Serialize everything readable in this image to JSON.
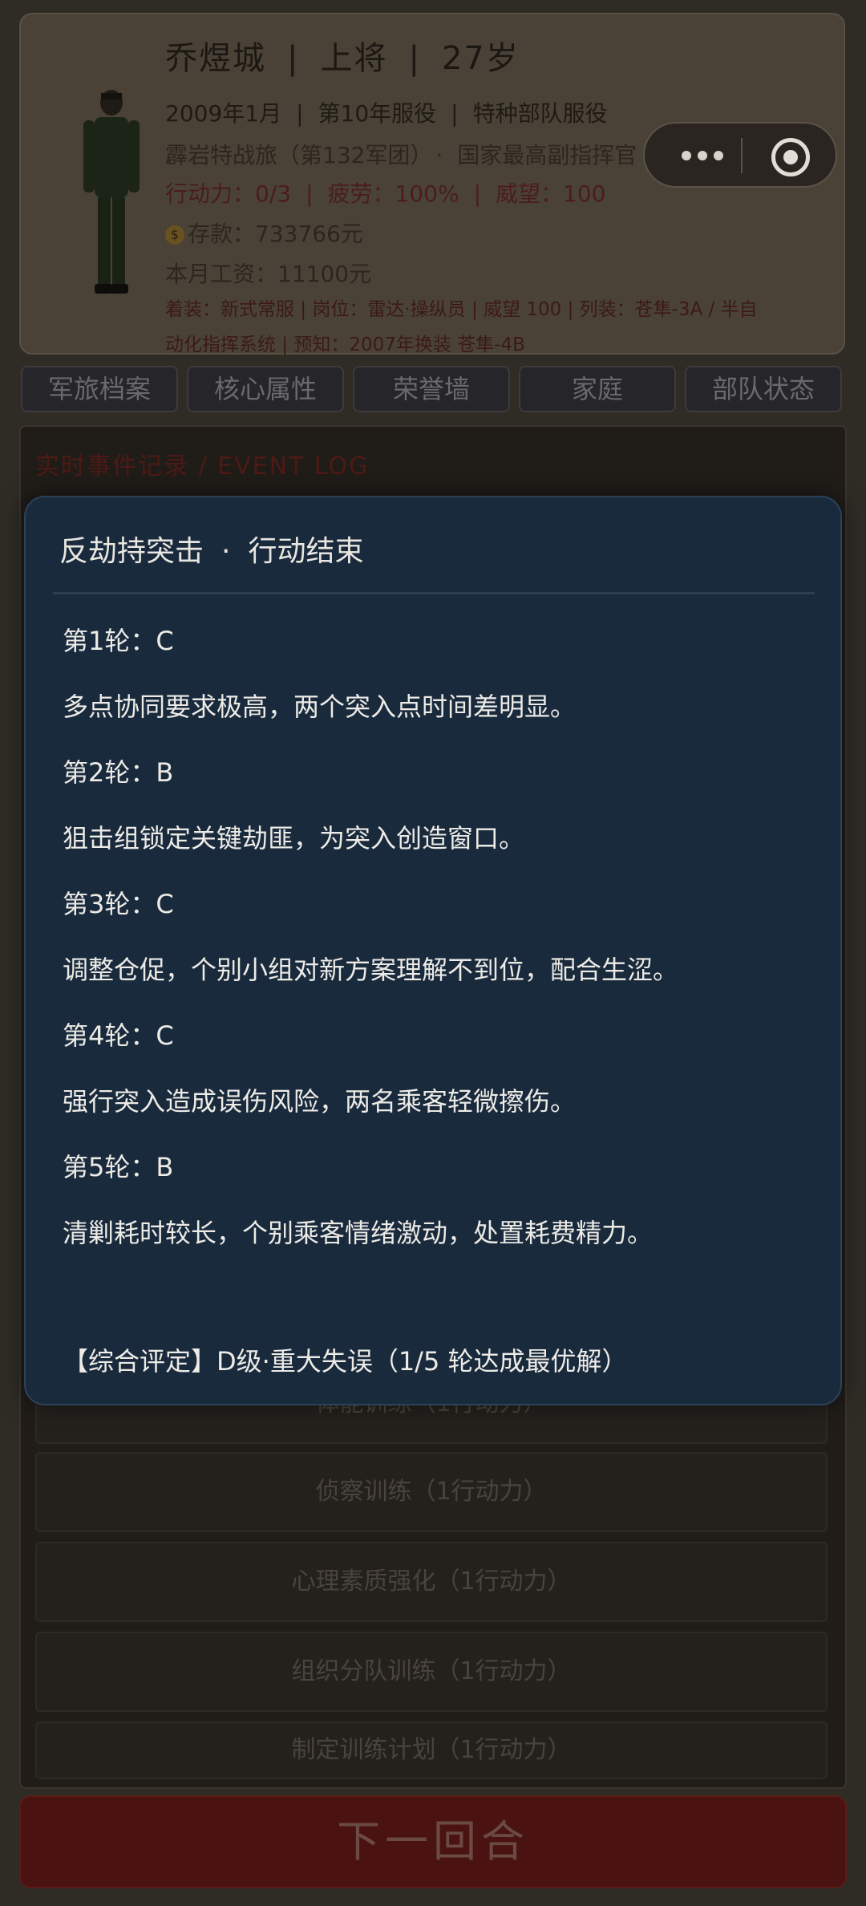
{
  "profile": {
    "name": "乔煜城",
    "rank": "上将",
    "age": "27岁",
    "enlist": "2009年1月",
    "service_year": "第10年服役",
    "service_type": "特种部队服役",
    "unit": "霹岩特战旅（第132军团）",
    "post": "国家最高副指挥官",
    "action": "行动力：0/3",
    "fatigue": "疲劳：100%",
    "prestige": "威望：100",
    "coin_icon": "coin-icon",
    "savings": "存款：733766元",
    "salary": "本月工资：11100元",
    "equip_line1": "着装：新式常服 | 岗位：雷达·操纵员 | 威望 100 | 列装：苍隼-3A / 半自",
    "equip_line2": "动化指挥系统 | 预知：2007年换装 苍隼-4B"
  },
  "tabs": [
    "军旅档案",
    "核心属性",
    "荣誉墙",
    "家庭",
    "部队状态"
  ],
  "events": {
    "title": "实时事件记录 / EVENT LOG",
    "trainings": [
      "体能训练（1行动力）",
      "侦察训练（1行动力）",
      "心理素质强化（1行动力）",
      "组织分队训练（1行动力）",
      "制定训练计划（1行动力）"
    ]
  },
  "next_button": "下一回合",
  "modal": {
    "title": "反劫持突击",
    "status": "行动结束",
    "rounds": [
      {
        "label": "第1轮：C",
        "desc": "多点协同要求极高，两个突入点时间差明显。"
      },
      {
        "label": "第2轮：B",
        "desc": "狙击组锁定关键劫匪，为突入创造窗口。"
      },
      {
        "label": "第3轮：C",
        "desc": "调整仓促，个别小组对新方案理解不到位，配合生涩。"
      },
      {
        "label": "第4轮：C",
        "desc": "强行突入造成误伤风险，两名乘客轻微擦伤。"
      },
      {
        "label": "第5轮：B",
        "desc": "清剿耗时较长，个别乘客情绪激动，处置耗费精力。"
      }
    ],
    "verdict": "【综合评定】D级·重大失误（1/5 轮达成最优解）"
  }
}
